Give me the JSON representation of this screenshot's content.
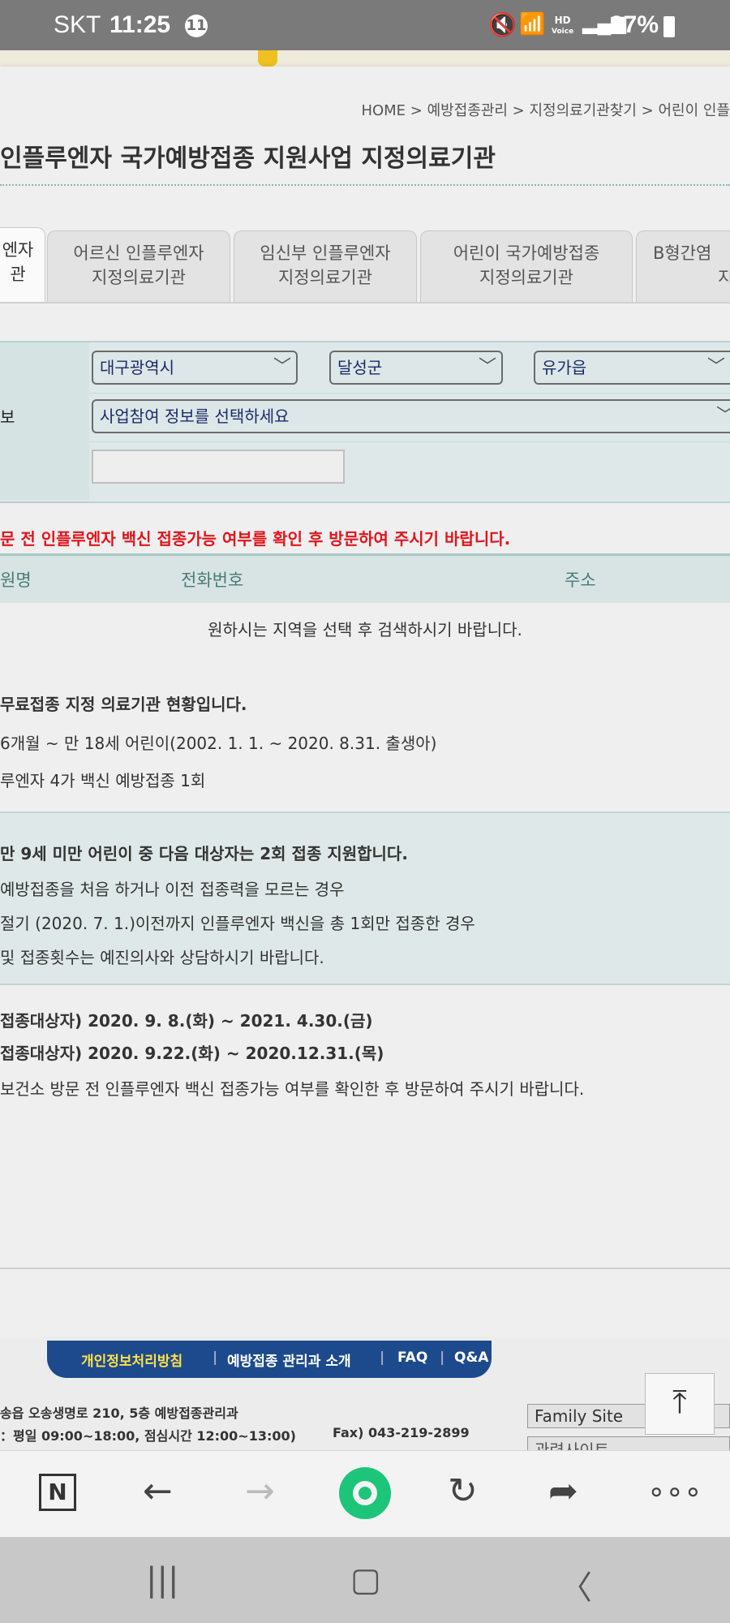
{
  "status": {
    "carrier": "SKT",
    "time": "11:25",
    "notification_count": "11",
    "hd_label": "HD",
    "voice_label": "Voice",
    "battery": "97%"
  },
  "breadcrumb": "HOME > 예방접종관리 > 지정의료기관찾기 > 어린이 인플",
  "page_title": "인플루엔자 국가예방접종 지원사업 지정의료기관",
  "tabs": [
    {
      "line1": "엔자",
      "line2": "관"
    },
    {
      "line1": "어르신 인플루엔자",
      "line2": "지정의료기관"
    },
    {
      "line1": "임신부 인플루엔자",
      "line2": "지정의료기관"
    },
    {
      "line1": "어린이 국가예방접종",
      "line2": "지정의료기관"
    },
    {
      "line1": "B형간염",
      "line2": "지정"
    }
  ],
  "search": {
    "region_label": "",
    "city": "대구광역시",
    "district": "달성군",
    "town": "유가읍",
    "info_label": "보",
    "info_select": "사업참여 정보를 선택하세요",
    "name_input": ""
  },
  "notice_red": "문 전 인플루엔자 백신 접종가능 여부를 확인 후 방문하여 주시기 바랍니다.",
  "table": {
    "col_name": "원명",
    "col_phone": "전화번호",
    "col_address": "주소",
    "empty_message": "원하시는 지역을 선택 후 검색하시기 바랍니다."
  },
  "info": {
    "line1": "무료접종 지정 의료기관 현황입니다.",
    "line2": "6개월 ~ 만 18세 어린이(2002. 1. 1. ~ 2020. 8.31. 출생아)",
    "line3": "루엔자 4가 백신 예방접종 1회",
    "box_line1_pre": "만 9세 미만 어린이 중 다음 대상자는 ",
    "box_line1_bold": "2회",
    "box_line1_post": " 접종 지원합니다.",
    "box_line2": "예방접종을 처음 하거나 이전 접종력을 모르는 경우",
    "box_line3": "절기 (2020. 7. 1.)이전까지 인플루엔자 백신을 총 1회만 접종한 경우",
    "box_line4": "및 접종횟수는 예진의사와 상담하시기 바랍니다.",
    "period1": "접종대상자) 2020. 9. 8.(화) ~ 2021. 4.30.(금)",
    "period2": "접종대상자) 2020. 9.22.(화) ~ 2020.12.31.(목)",
    "visit_note": "보건소 방문 전 인플루엔자 백신 접종가능 여부를 확인한 후 방문하여 주시기 바랍니다."
  },
  "footer": {
    "links": [
      "개인정보처리방침",
      "예방접종 관리과 소개",
      "FAQ",
      "Q&A"
    ],
    "address": "송읍 오송생명로 210, 5층 예방접종관리과",
    "hours": "：평일 09:00~18:00, 점심시간 12:00~13:00)",
    "fax": "Fax) 043-219-2899",
    "family_site": "Family Site",
    "related_site": "관련사이트"
  }
}
